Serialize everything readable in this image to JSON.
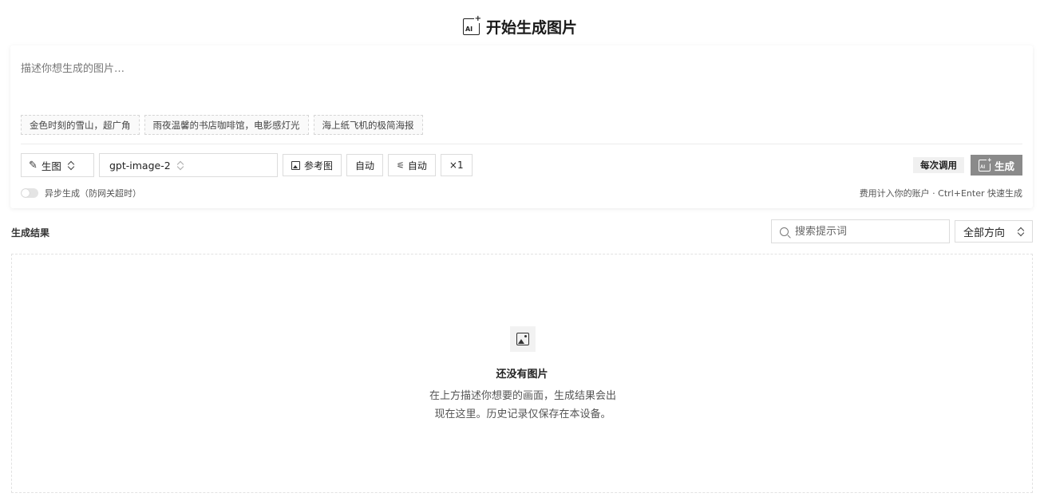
{
  "header": {
    "title": "开始生成图片",
    "icon": "ai-image-icon",
    "icon_text": "AI"
  },
  "prompt": {
    "placeholder": "描述你想生成的图片…",
    "value": ""
  },
  "suggestions": [
    "金色时刻的雪山，超广角",
    "雨夜温馨的书店咖啡馆，电影感灯光",
    "海上纸飞机的极简海报"
  ],
  "controls": {
    "mode": "生图",
    "model": "gpt-image-2",
    "reference": "参考图",
    "size": "自动",
    "quality": "自动",
    "count": "×1"
  },
  "actions": {
    "cost_badge": "每次调用",
    "generate": "生成"
  },
  "async": {
    "label": "异步生成（防网关超时）",
    "enabled": false
  },
  "footnote": "费用计入你的账户 · Ctrl+Enter 快速生成",
  "results": {
    "title": "生成结果",
    "search_placeholder": "搜索提示词",
    "direction": "全部方向",
    "empty_title": "还没有图片",
    "empty_desc_1": "在上方描述你想要的画面，生成结果会出",
    "empty_desc_2": "现在这里。历史记录仅保存在本设备。"
  },
  "colors": {
    "generate_bg": "#8a8a8a",
    "badge_bg": "#f0f0f0"
  }
}
